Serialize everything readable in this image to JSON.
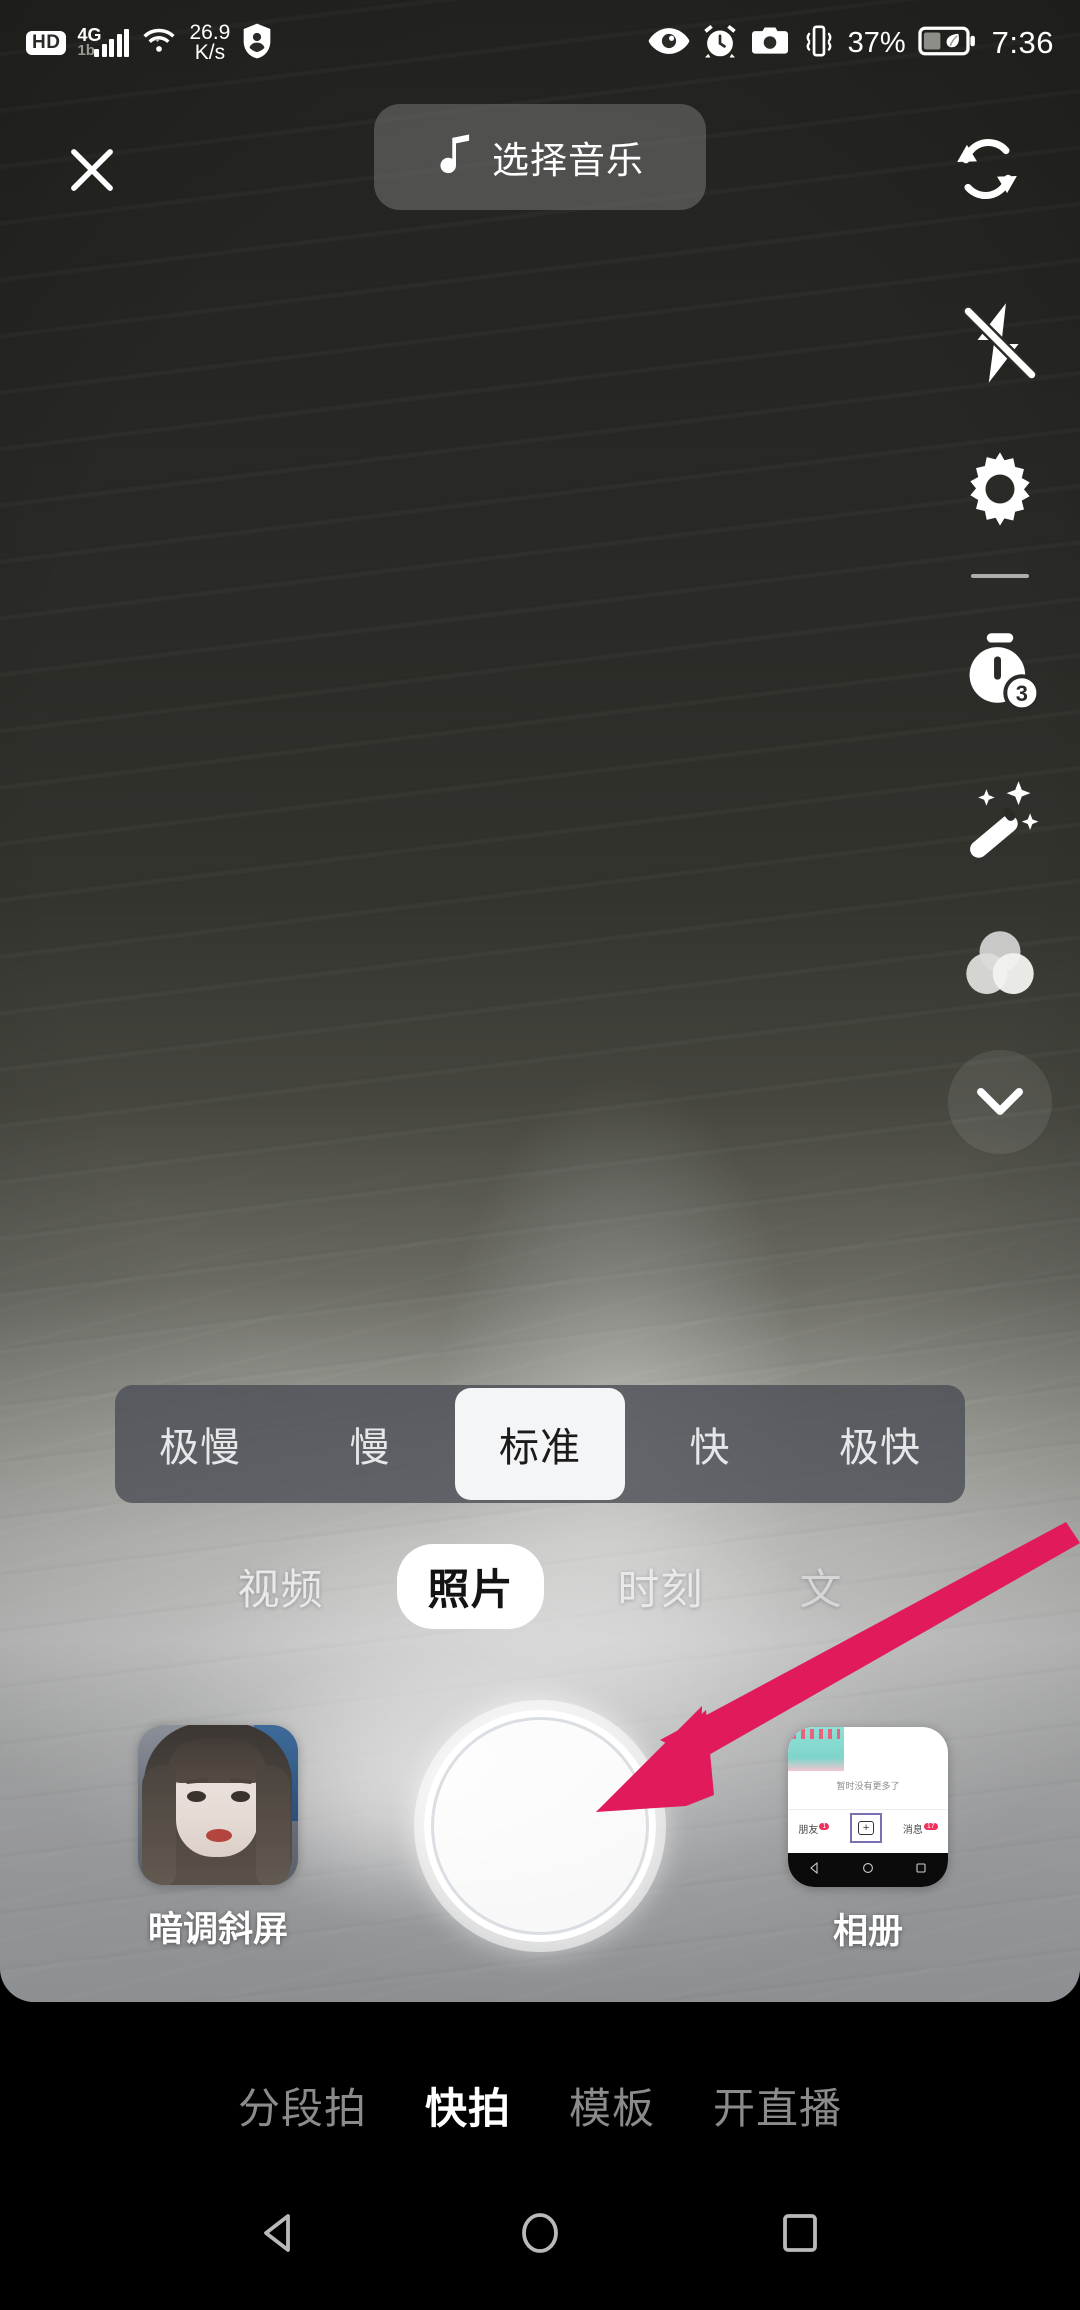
{
  "status_bar": {
    "hd_label": "HD",
    "network_type": "4G",
    "network_sub": "1b",
    "net_speed_value": "26.9",
    "net_speed_unit": "K/s",
    "battery_percent": "37%",
    "time": "7:36",
    "icons_left": [
      "hd-badge",
      "signal-bars-icon",
      "wifi-icon",
      "net-speed",
      "shield-person-icon"
    ],
    "icons_right": [
      "eye-icon",
      "alarm-clock-icon",
      "camera-icon",
      "vibrate-icon",
      "battery-icon"
    ]
  },
  "top_bar": {
    "close_icon": "close-icon",
    "music_icon": "music-note-icon",
    "music_label": "选择音乐",
    "flip_icon": "flip-camera-icon"
  },
  "right_rail": {
    "items": [
      {
        "name": "flash-off-icon",
        "label": "闪光灯关闭"
      },
      {
        "name": "gear-icon",
        "label": "设置"
      },
      {
        "name": "timer-icon",
        "label": "倒计时",
        "badge": "3"
      },
      {
        "name": "magic-wand-icon",
        "label": "美化"
      },
      {
        "name": "filter-circles-icon",
        "label": "滤镜"
      },
      {
        "name": "chevron-down-icon",
        "label": "收起"
      }
    ],
    "timer_badge": "3"
  },
  "speed_selector": {
    "options": [
      "极慢",
      "慢",
      "标准",
      "快",
      "极快"
    ],
    "selected_index": 2
  },
  "mode_tabs": {
    "tabs": [
      "视频",
      "照片",
      "时刻",
      "文"
    ],
    "selected_index": 1
  },
  "capture_row": {
    "effect_thumb_label": "暗调斜屏",
    "shutter_label": "拍照",
    "album_label": "相册",
    "album_preview": {
      "empty_text": "暂时没有更多了",
      "tab_friends": "朋友",
      "tab_friends_badge": "1",
      "tab_messages": "消息",
      "tab_messages_badge": "17",
      "plus_label": "+"
    }
  },
  "bottom_tabs": {
    "tabs": [
      "分段拍",
      "快拍",
      "模板",
      "开直播"
    ],
    "selected_index": 1
  },
  "android_nav": {
    "back": "back-icon",
    "home": "home-icon",
    "recents": "recents-icon"
  },
  "annotation": {
    "arrow_color": "#E01A5B",
    "arrow_target": "shutter-button"
  },
  "colors": {
    "accent_pink": "#E01A5B",
    "selected_pill": "#FFFFFF",
    "speed_bar_bg": "rgba(74,78,84,0.80)"
  }
}
